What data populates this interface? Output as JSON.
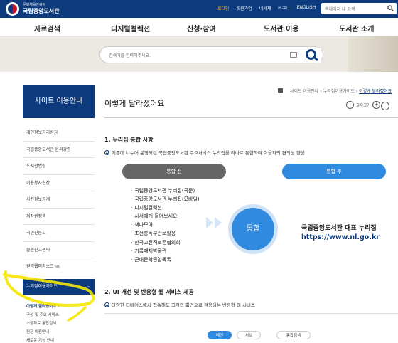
{
  "header": {
    "ministry": "문화체육관광부",
    "library_name": "국립중앙도서관",
    "utility_links": [
      "로그인",
      "회원가입",
      "내서재",
      "바구니",
      "ENGLISH"
    ],
    "active_utility": "로그인",
    "site_search_placeholder": "홈페이지 내 검색"
  },
  "gnb": [
    "자료검색",
    "디지털컬렉션",
    "신청·참여",
    "도서관 이용",
    "도서관 소개"
  ],
  "main_search": {
    "placeholder": "검색어를 입력해주세요."
  },
  "sidebar": {
    "title": "사이트 이용안내",
    "items": [
      {
        "label": "개인정보처리방침",
        "badge": ""
      },
      {
        "label": "국립중앙도서관 윤리강령",
        "badge": ""
      },
      {
        "label": "도서관법령",
        "badge": ""
      },
      {
        "label": "이용봉사헌장",
        "badge": ""
      },
      {
        "label": "사전정보공개",
        "badge": ""
      },
      {
        "label": "저작권정책",
        "badge": ""
      },
      {
        "label": "국민신문고",
        "badge": ""
      },
      {
        "label": "클린신고센터",
        "badge": ""
      },
      {
        "label": "원격웹퍼지스크",
        "badge": "새창"
      }
    ],
    "active_item": {
      "label": "누리집이용가이드",
      "toggle": "–"
    },
    "sub_items": [
      {
        "label": "이렇게 달라졌어요",
        "marker": "‹"
      },
      {
        "label": "구성 및 주요 서비스",
        "marker": ""
      },
      {
        "label": "소장자료 통합검색",
        "marker": ""
      },
      {
        "label": "원문 이용안내",
        "marker": ""
      },
      {
        "label": "새로운 기능 안내",
        "marker": ""
      }
    ]
  },
  "breadcrumb": [
    "사이트 이용안내",
    "누리집이용가이드",
    "이렇게 달라졌어요"
  ],
  "page": {
    "title": "이렇게 달라졌어요",
    "font_size_label": "글자크기",
    "font_minus": "–",
    "font_plus": "+"
  },
  "section1": {
    "title": "1. 누리집 통합 사항",
    "desc": "기존에 나누어 운영되던 국립중앙도서관 주요서비스 누리집을 하나로 통합하여 이용자의 편의성 향상",
    "before_label": "통합 전",
    "after_label": "통합 후",
    "old_sites": [
      "국립중앙도서관 누리집(국문)",
      "국립중앙도서관 누리집(모바일)",
      "디지털컬렉션",
      "사서에게 물어보세요",
      "책다모아",
      "조선총독부관보활용",
      "한국고전적보존협의회",
      "기록매체박물관",
      "근대문학종합목록"
    ],
    "merge_label": "통합",
    "rep_title": "국립중앙도서관 대표 누리집",
    "rep_url": "https://www.nl.go.kr"
  },
  "section2": {
    "title": "2. UI 개선 및 반응형 웹 서비스 제공",
    "desc": "다양한 디바이스에서 접속해도 최적의 화면으로 적용되는 반응형 웹 서비스",
    "tabs": [
      "메인",
      "서브",
      "통합검색"
    ],
    "selected_tab": "메인"
  },
  "colors": {
    "brand": "#0c3a7c",
    "accent": "#2f8ae0",
    "before_pill": "#666666",
    "highlight": "#f5e600"
  },
  "icons": [
    "search-icon",
    "keyboard-icon",
    "home-icon",
    "print-icon",
    "share-icon",
    "check-icon"
  ]
}
